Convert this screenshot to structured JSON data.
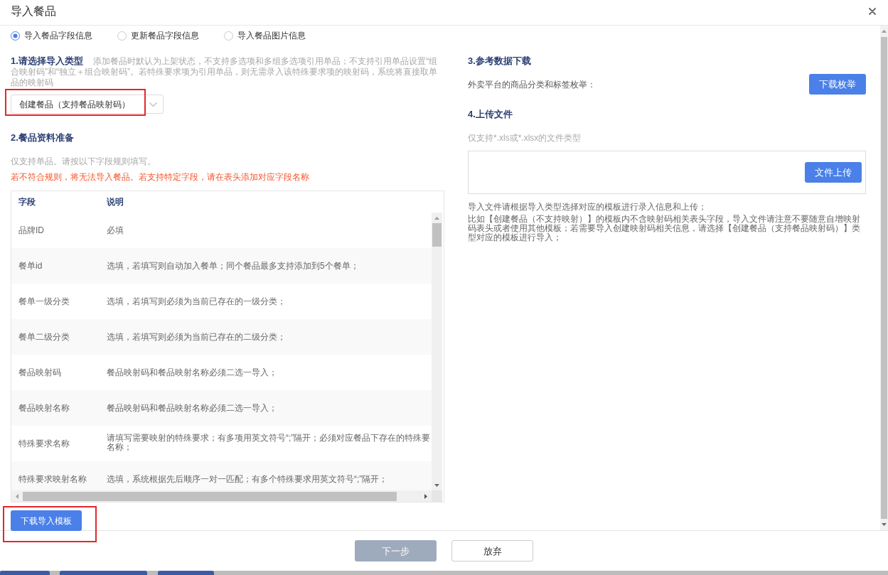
{
  "window": {
    "title": "导入餐品"
  },
  "import_modes": [
    {
      "label": "导入餐品字段信息",
      "selected": true
    },
    {
      "label": "更新餐品字段信息",
      "selected": false
    },
    {
      "label": "导入餐品图片信息",
      "selected": false
    }
  ],
  "step1": {
    "heading": "1.请选择导入类型",
    "note": "添加餐品时默认为上架状态，不支持多选项和多组多选项引用单品；不支持引用单品设置“组合映射码”和“独立＋组合映射码”。若特殊要求项为引用单品，则无需录入该特殊要求项的映射码，系统将直接取单品的映射码",
    "select": {
      "value": "创建餐品（支持餐品映射码）",
      "highlighted": true
    }
  },
  "step2": {
    "heading": "2.餐品资料准备",
    "hint": "仅支持单品。请按以下字段规则填写。",
    "warning": "若不符合规则，将无法导入餐品。若支持特定字段，请在表头添加对应字段名称",
    "table": {
      "columns": [
        "字段",
        "说明"
      ],
      "rows": [
        {
          "field": "品牌ID",
          "description": "必填"
        },
        {
          "field": "餐单id",
          "description": "选填，若填写则自动加入餐单；同个餐品最多支持添加到5个餐单；"
        },
        {
          "field": "餐单一级分类",
          "description": "选填，若填写则必须为当前已存在的一级分类；"
        },
        {
          "field": "餐单二级分类",
          "description": "选填，若填写则必须为当前已存在的二级分类；"
        },
        {
          "field": "餐品映射码",
          "description": "餐品映射码和餐品映射名称必须二选一导入；"
        },
        {
          "field": "餐品映射名称",
          "description": "餐品映射码和餐品映射名称必须二选一导入；"
        },
        {
          "field": "特殊要求名称",
          "description": "请填写需要映射的特殊要求；有多项用英文符号“;”隔开；必须对应餐品下存在的特殊要名称；"
        },
        {
          "field": "特殊要求映射名称",
          "description": "选填，系统根据先后顺序一对一匹配；有多个特殊要求用英文符号“;”隔开；"
        }
      ]
    }
  },
  "download_template": {
    "label": "下载导入模板",
    "highlighted": true
  },
  "step3": {
    "heading": "3.参考数据下载",
    "text": "外卖平台的商品分类和标签枚举：",
    "button": "下载枚举"
  },
  "step4": {
    "heading": "4.上传文件",
    "hint": "仅支持*.xls或*.xlsx的文件类型",
    "button": "文件上传",
    "notes": [
      "导入文件请根据导入类型选择对应的模板进行录入信息和上传；",
      "比如【创建餐品（不支持映射）】的模板内不含映射码相关表头字段，导入文件请注意不要随意自增映射码表头或者使用其他模板；若需要导入创建映射码相关信息，请选择【创建餐品（支持餐品映射码）】类型对应的模板进行导入；"
    ]
  },
  "footer": {
    "buttons": [
      {
        "label": "下一步",
        "kind": "primary",
        "disabled": true
      },
      {
        "label": "放弃",
        "kind": "secondary",
        "disabled": false
      }
    ]
  }
}
